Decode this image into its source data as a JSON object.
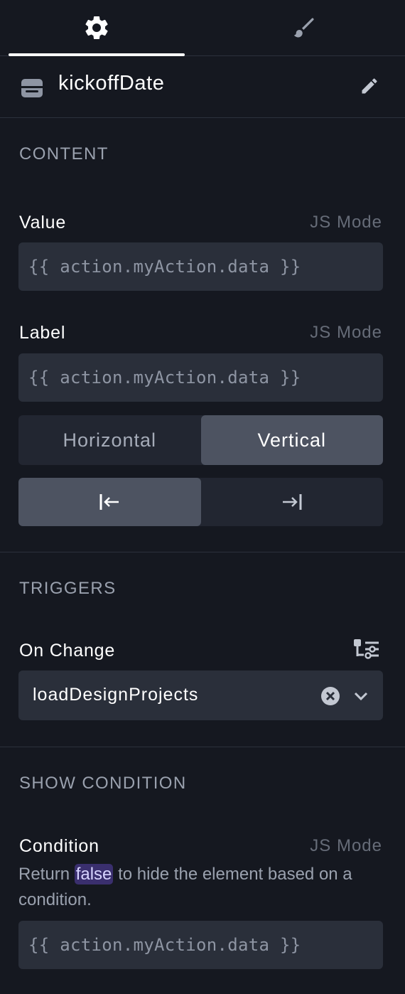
{
  "tabs": [
    {
      "name": "settings",
      "icon": "gear-icon",
      "active": true
    },
    {
      "name": "style",
      "icon": "brush-icon",
      "active": false
    }
  ],
  "header": {
    "title": "kickoffDate",
    "icon": "component-icon",
    "edit_icon": "pencil-icon"
  },
  "content": {
    "section_title": "CONTENT",
    "value": {
      "label": "Value",
      "js_mode": "JS Mode",
      "code": "{{ action.myAction.data }}"
    },
    "label": {
      "label": "Label",
      "js_mode": "JS Mode",
      "code": "{{ action.myAction.data }}"
    },
    "orientation": {
      "options": [
        "Horizontal",
        "Vertical"
      ],
      "selected": "Vertical"
    },
    "alignment": {
      "options": [
        "align-left-icon",
        "align-right-icon"
      ],
      "selected": "align-left-icon"
    }
  },
  "triggers": {
    "section_title": "TRIGGERS",
    "on_change": {
      "label": "On Change",
      "settings_icon": "sliders-icon",
      "value": "loadDesignProjects"
    }
  },
  "show_condition": {
    "section_title": "SHOW CONDITION",
    "condition": {
      "label": "Condition",
      "js_mode": "JS Mode",
      "desc_before": "Return ",
      "desc_keyword": "false",
      "desc_after": " to hide the element based on a condition.",
      "code": "{{ action.myAction.data }}"
    }
  },
  "colors": {
    "background": "#151820",
    "input": "#2a2f3a",
    "segment_active": "#4d5361",
    "highlight": "#3a2f6e"
  }
}
